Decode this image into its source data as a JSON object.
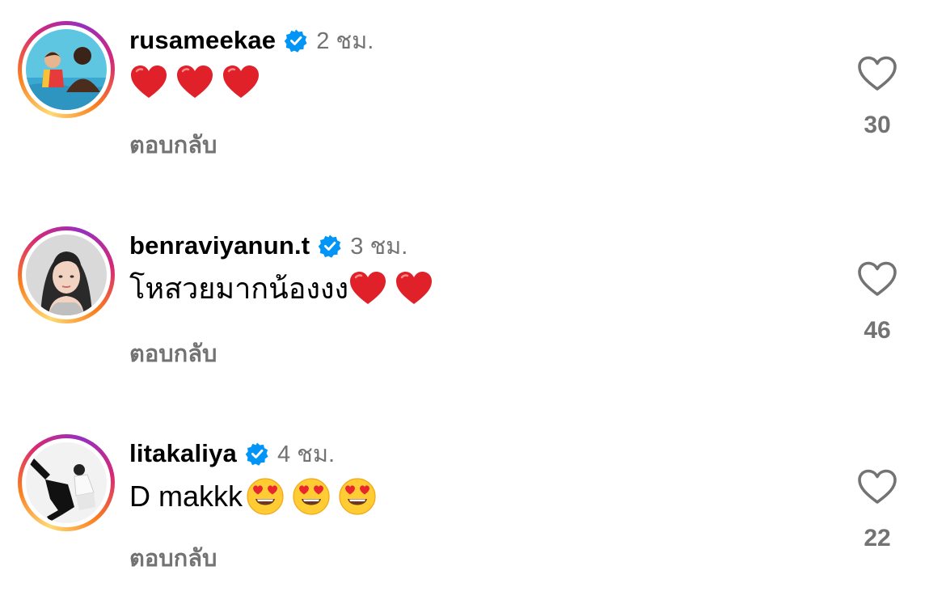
{
  "comments": [
    {
      "username": "rusameekae",
      "verified": true,
      "time": "2 ชม.",
      "text": "",
      "emojis": [
        "red-heart",
        "red-heart",
        "red-heart"
      ],
      "reply_label": "ตอบกลับ",
      "likes": "30"
    },
    {
      "username": "benraviyanun.t",
      "verified": true,
      "time": "3 ชม.",
      "text": "โหสวยมากน้องงง",
      "emojis": [
        "red-heart",
        "red-heart"
      ],
      "reply_label": "ตอบกลับ",
      "likes": "46"
    },
    {
      "username": "litakaliya",
      "verified": true,
      "time": "4 ชม.",
      "text": "D makkk",
      "emojis": [
        "heart-eyes",
        "heart-eyes",
        "heart-eyes"
      ],
      "reply_label": "ตอบกลับ",
      "likes": "22"
    }
  ],
  "colors": {
    "verified_blue": "#0095f6",
    "secondary_text": "#737373",
    "heart_red": "#e0212a"
  },
  "icons": {
    "like": "heart-outline-icon",
    "verified": "verified-badge-icon"
  }
}
